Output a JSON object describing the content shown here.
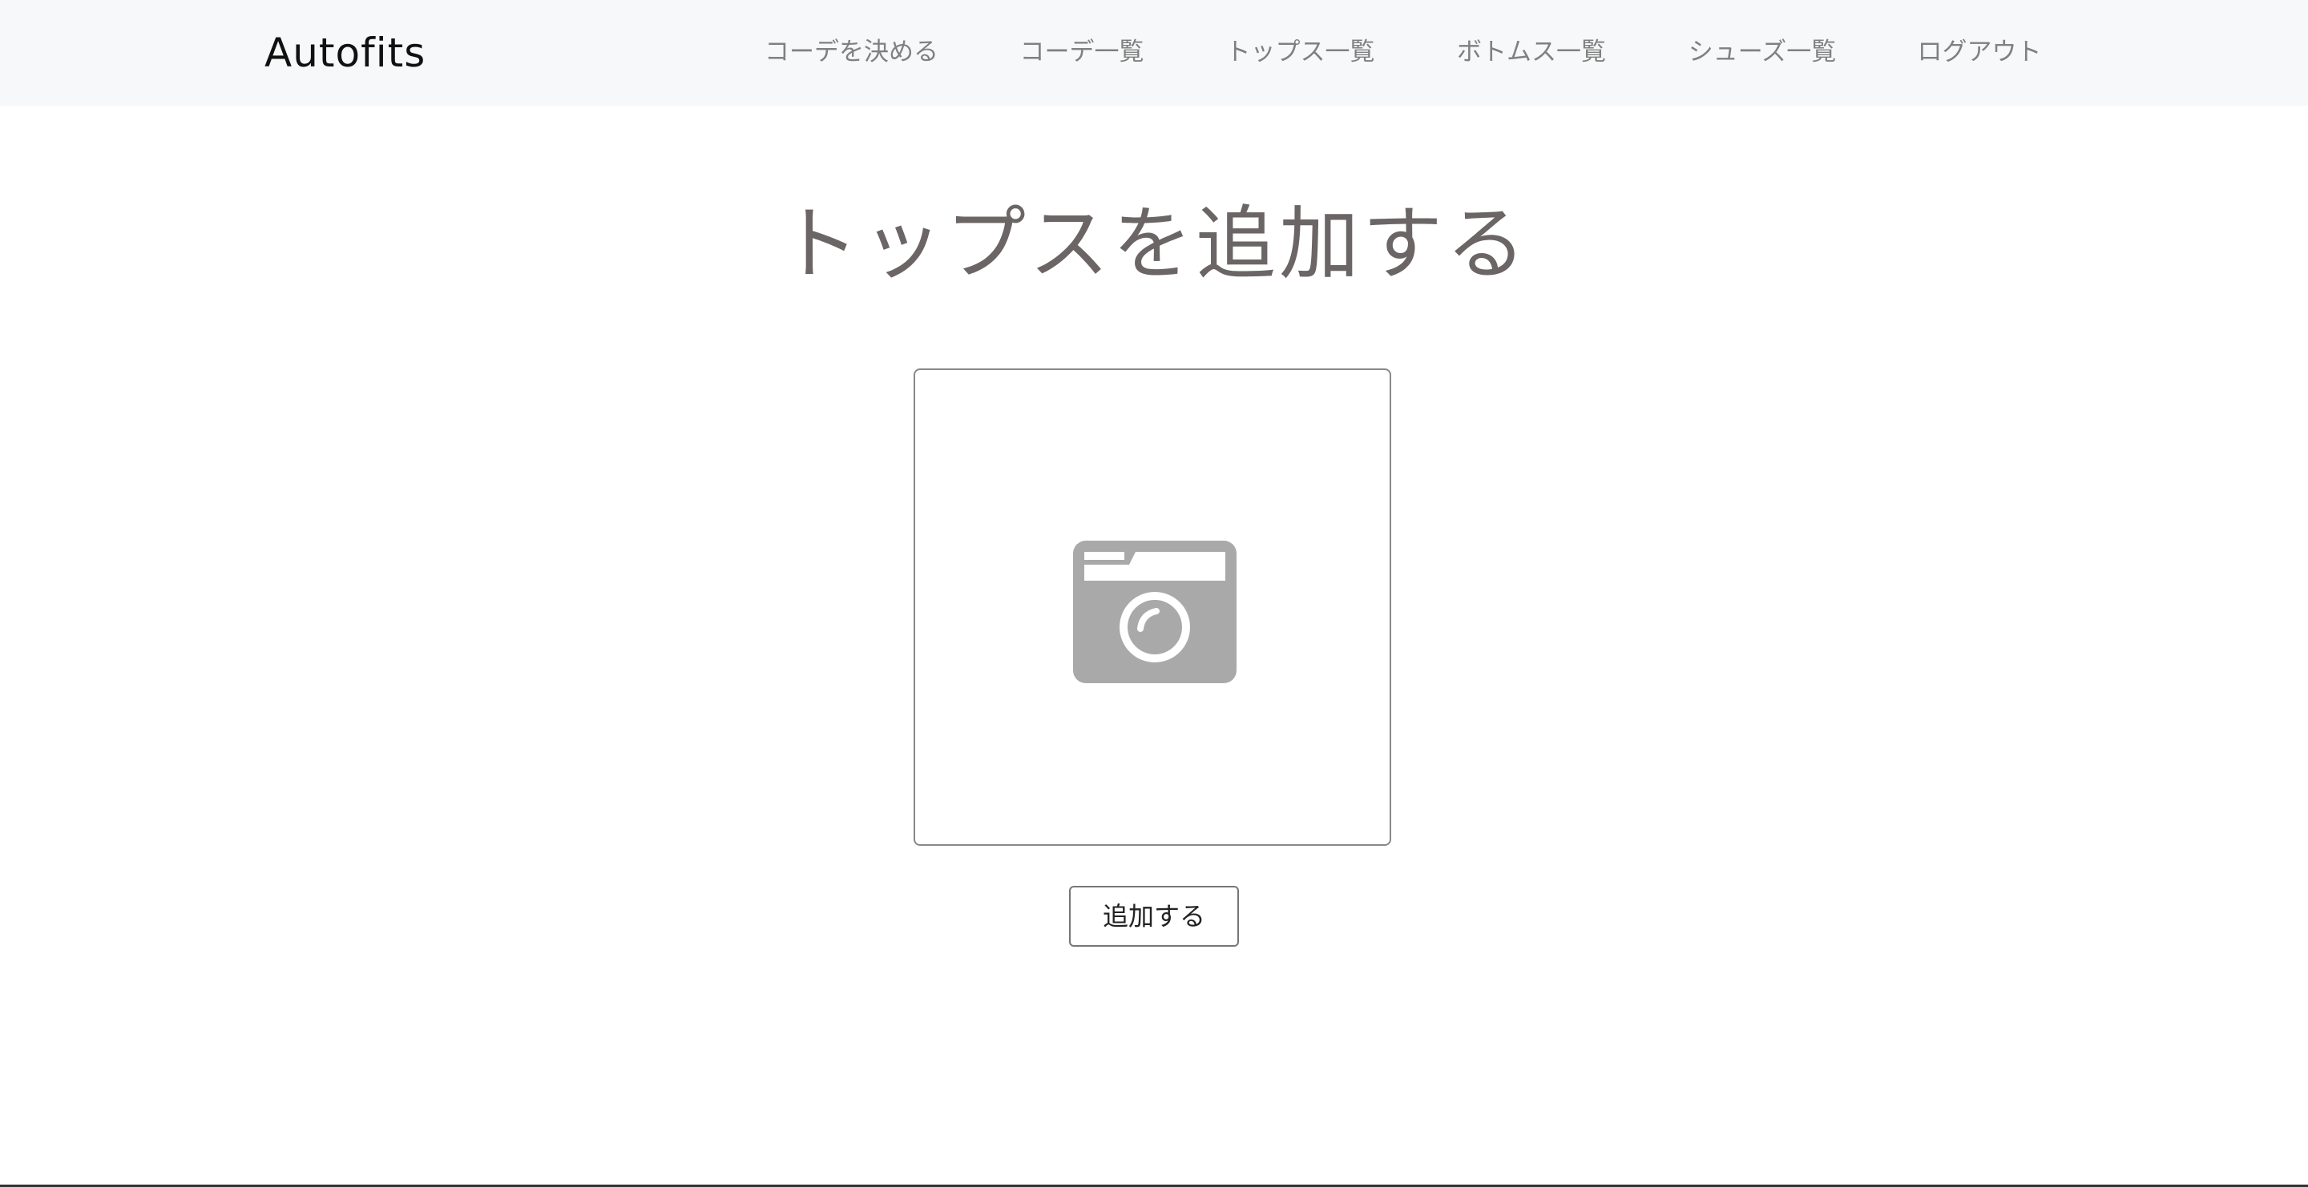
{
  "navbar": {
    "brand": "Autofits",
    "links": [
      {
        "label": "コーデを決める"
      },
      {
        "label": "コーデ一覧"
      },
      {
        "label": "トップス一覧"
      },
      {
        "label": "ボトムス一覧"
      },
      {
        "label": "シューズ一覧"
      },
      {
        "label": "ログアウト"
      }
    ]
  },
  "main": {
    "title": "トップスを追加する",
    "image_picker": {
      "icon": "camera-icon"
    },
    "submit_label": "追加する"
  },
  "colors": {
    "navbar_bg": "#f7f8f9",
    "nav_text": "#808080",
    "title_text": "#6b6565",
    "icon_fill": "#a9a9a9"
  }
}
